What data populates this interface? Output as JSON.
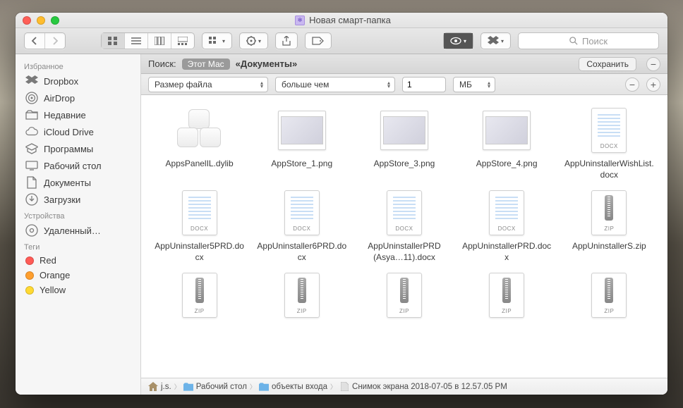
{
  "window": {
    "title": "Новая смарт-папка"
  },
  "toolbar": {
    "search_placeholder": "Поиск"
  },
  "sidebar": {
    "favorites_label": "Избранное",
    "favorites": [
      {
        "name": "Dropbox",
        "icon": "dropbox"
      },
      {
        "name": "AirDrop",
        "icon": "airdrop"
      },
      {
        "name": "Недавние",
        "icon": "recents"
      },
      {
        "name": "iCloud Drive",
        "icon": "icloud"
      },
      {
        "name": "Программы",
        "icon": "apps"
      },
      {
        "name": "Рабочий стол",
        "icon": "desktop"
      },
      {
        "name": "Документы",
        "icon": "documents"
      },
      {
        "name": "Загрузки",
        "icon": "downloads"
      }
    ],
    "devices_label": "Устройства",
    "devices": [
      {
        "name": "Удаленный…",
        "icon": "disc"
      }
    ],
    "tags_label": "Теги",
    "tags": [
      {
        "name": "Red",
        "color": "#ff5b56"
      },
      {
        "name": "Orange",
        "color": "#ff9f2e"
      },
      {
        "name": "Yellow",
        "color": "#ffd932"
      }
    ]
  },
  "scope": {
    "label": "Поиск:",
    "this_mac": "Этот Мас",
    "documents": "«Документы»",
    "save": "Сохранить"
  },
  "criteria": {
    "attribute": "Размер файла",
    "operator": "больше чем",
    "value": "1",
    "unit": "МБ"
  },
  "files": [
    [
      {
        "name": "AppsPanelIL.dylib",
        "type": "dylib"
      },
      {
        "name": "AppStore_1.png",
        "type": "png"
      },
      {
        "name": "AppStore_3.png",
        "type": "png"
      },
      {
        "name": "AppStore_4.png",
        "type": "png"
      },
      {
        "name": "AppUninstallerWishList.docx",
        "type": "docx"
      }
    ],
    [
      {
        "name": "AppUninstaller5PRD.docx",
        "type": "docx"
      },
      {
        "name": "AppUninstaller6PRD.docx",
        "type": "docx"
      },
      {
        "name": "AppUninstallerPRD (Asya…11).docx",
        "type": "docx"
      },
      {
        "name": "AppUninstallerPRD.docx",
        "type": "docx"
      },
      {
        "name": "AppUninstallerS.zip",
        "type": "zip"
      }
    ],
    [
      {
        "name": "",
        "type": "zip"
      },
      {
        "name": "",
        "type": "zip"
      },
      {
        "name": "",
        "type": "zip"
      },
      {
        "name": "",
        "type": "zip"
      },
      {
        "name": "",
        "type": "zip"
      }
    ]
  ],
  "path": {
    "items": [
      {
        "icon": "home",
        "label": "j.s."
      },
      {
        "icon": "folder",
        "label": "Рабочий стол"
      },
      {
        "icon": "folder",
        "label": "объекты входа"
      },
      {
        "icon": "file",
        "label": "Снимок экрана 2018-07-05 в 12.57.05 PM"
      }
    ]
  }
}
